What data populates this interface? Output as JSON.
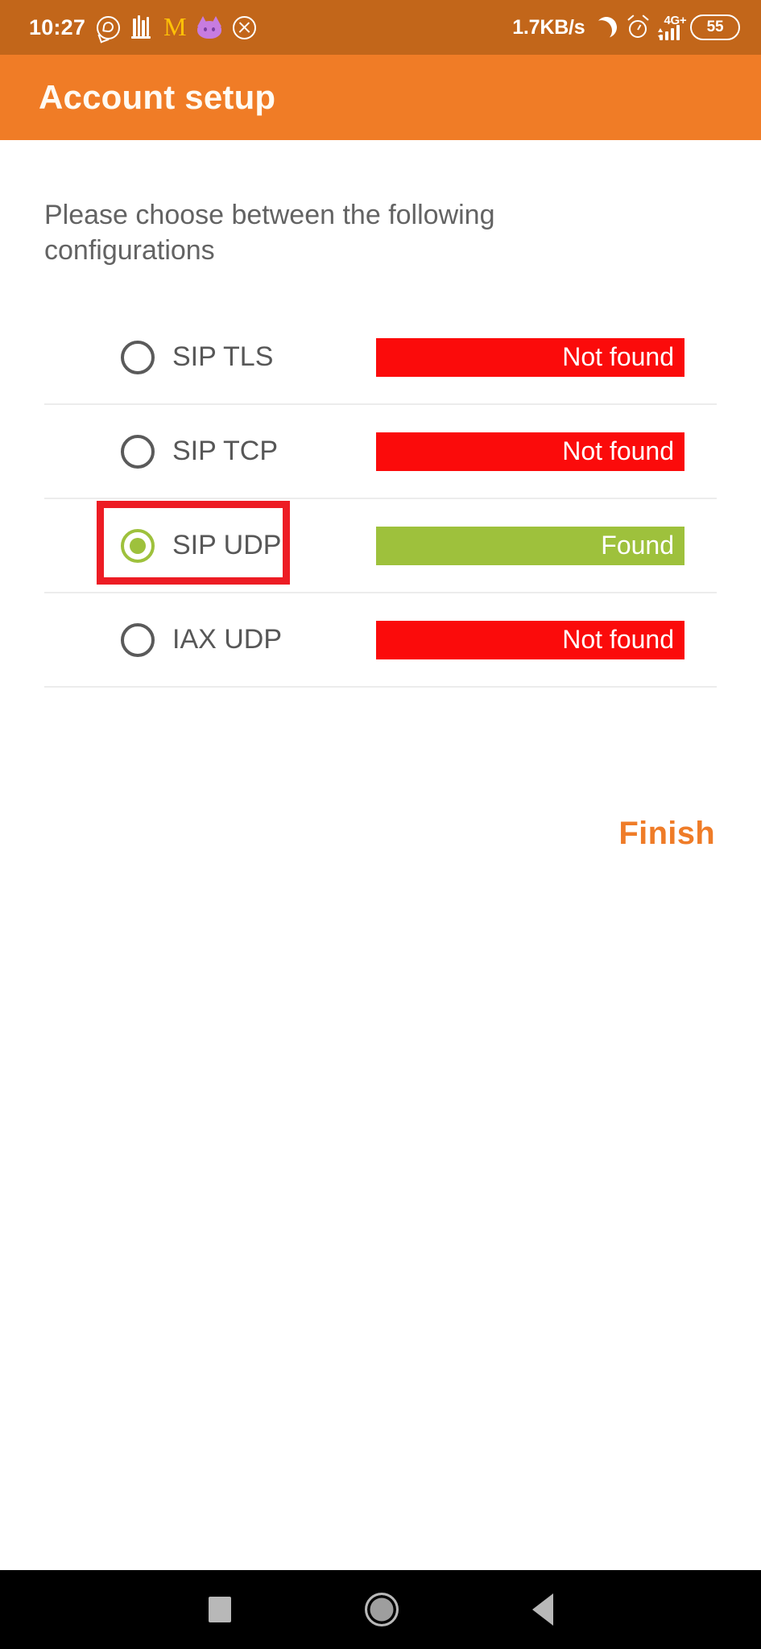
{
  "status_bar": {
    "time": "10:27",
    "network_speed": "1.7KB/s",
    "battery_level": "55",
    "mobile_network": "4G+",
    "mcdonalds_glyph": "M",
    "icons_left": [
      "whatsapp-icon",
      "notification-icon",
      "mcdonalds-icon",
      "cat-app-icon",
      "close-circle-icon"
    ],
    "icons_right": [
      "do-not-disturb-moon-icon",
      "alarm-clock-icon",
      "signal-bars-icon",
      "battery-icon"
    ],
    "background_color": "#c2661a"
  },
  "app_bar": {
    "title": "Account setup",
    "background_color": "#f07c26",
    "title_color": "#fffaf2"
  },
  "content": {
    "instruction": "Please choose between the following configurations",
    "options": [
      {
        "label": "SIP TLS",
        "selected": false,
        "status": "Not found",
        "status_type": "notfound"
      },
      {
        "label": "SIP TCP",
        "selected": false,
        "status": "Not found",
        "status_type": "notfound"
      },
      {
        "label": "SIP UDP",
        "selected": true,
        "status": "Found",
        "status_type": "found"
      },
      {
        "label": "IAX UDP",
        "selected": false,
        "status": "Not found",
        "status_type": "notfound"
      }
    ],
    "finish_label": "Finish",
    "colors": {
      "not_found": "#fb0b0b",
      "found": "#9ec13c",
      "accent": "#ef7c28",
      "highlight": "#ed1c24"
    }
  },
  "nav_bar": {
    "buttons": [
      "recents-button",
      "home-button",
      "back-button"
    ],
    "background_color": "#000000"
  }
}
